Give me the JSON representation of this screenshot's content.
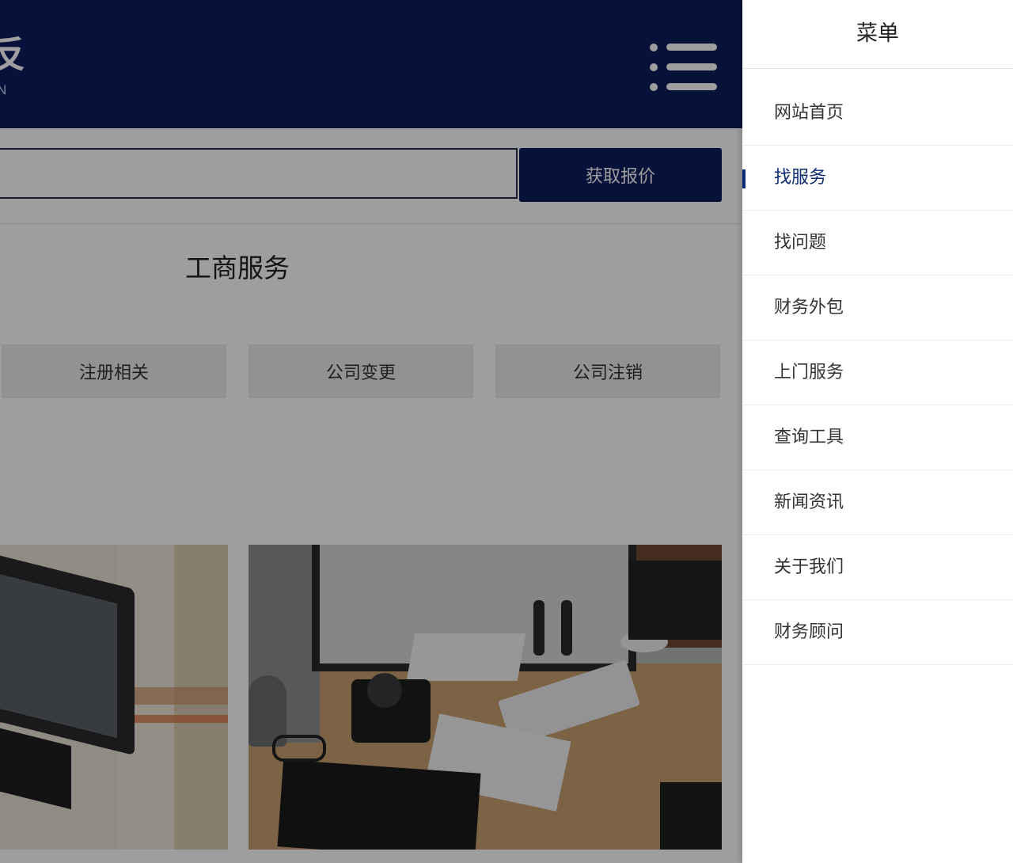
{
  "header": {
    "logo_glyph": "反",
    "logo_sub": "N",
    "menu_icon": "hamburger-menu-icon",
    "bg_color": "#0b1d5e"
  },
  "search": {
    "value": "",
    "placeholder": "",
    "button_label": "获取报价"
  },
  "section": {
    "title": "工商服务",
    "categories": [
      "注册相关",
      "公司变更",
      "公司注销"
    ]
  },
  "drawer": {
    "title": "菜单",
    "active_index": 1,
    "accent_color": "#0b2a73",
    "items": [
      {
        "label": "网站首页"
      },
      {
        "label": "找服务"
      },
      {
        "label": "找问题"
      },
      {
        "label": "财务外包"
      },
      {
        "label": "上门服务"
      },
      {
        "label": "查询工具"
      },
      {
        "label": "新闻资讯"
      },
      {
        "label": "关于我们"
      },
      {
        "label": "财务顾问"
      }
    ]
  }
}
